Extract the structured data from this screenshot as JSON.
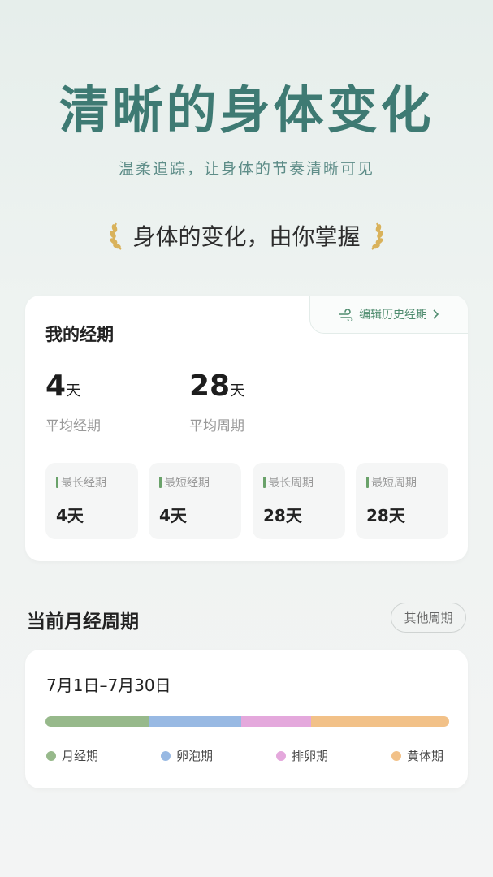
{
  "hero": {
    "title": "清晰的身体变化",
    "subtitle": "温柔追踪，让身体的节奏清晰可见",
    "slogan": "身体的变化，由你掌握"
  },
  "period_card": {
    "title": "我的经期",
    "edit_label": "编辑历史经期",
    "avg_period": {
      "value": "4",
      "unit": "天",
      "label": "平均经期"
    },
    "avg_cycle": {
      "value": "28",
      "unit": "天",
      "label": "平均周期"
    },
    "stats": [
      {
        "label": "最长经期",
        "value": "4天"
      },
      {
        "label": "最短经期",
        "value": "4天"
      },
      {
        "label": "最长周期",
        "value": "28天"
      },
      {
        "label": "最短周期",
        "value": "28天"
      }
    ]
  },
  "current_cycle": {
    "section_title": "当前月经周期",
    "other_label": "其他周期",
    "range": "7月1日–7月30日",
    "phases": [
      {
        "name": "月经期",
        "color": "#97b98b",
        "fraction": 0.258
      },
      {
        "name": "卵泡期",
        "color": "#98b9e3",
        "fraction": 0.226
      },
      {
        "name": "排卵期",
        "color": "#e4a8dc",
        "fraction": 0.173
      },
      {
        "name": "黄体期",
        "color": "#f2c188",
        "fraction": 0.343
      }
    ]
  },
  "colors": {
    "brand": "#3e7a73",
    "accent_green": "#4f8c6f",
    "laurel": "#d9b25a"
  }
}
